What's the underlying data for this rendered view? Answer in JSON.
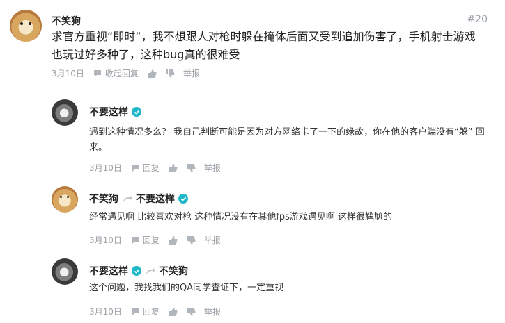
{
  "main": {
    "user": "不笑狗",
    "floor": "#20",
    "text": "求官方重视“即时”，我不想跟人对枪时躲在掩体后面又受到追加伤害了，手机射击游戏也玩过好多种了，这种bug真的很难受",
    "date": "3月10日",
    "collapse_label": "收起回复",
    "report_label": "举报"
  },
  "replies": [
    {
      "user": "不要这样",
      "verified": true,
      "reply_to": "",
      "text": "遇到这种情况多么？ 我自己判断可能是因为对方网络卡了一下的缘故，你在他的客户端没有“躲” 回来。",
      "date": "3月10日",
      "reply_label": "回复",
      "report_label": "举报"
    },
    {
      "user": "不笑狗",
      "verified": false,
      "reply_to": "不要这样",
      "reply_to_verified": true,
      "text": "经常遇见啊 比较喜欢对枪 这种情况没有在其他fps游戏遇见啊 这样很尴尬的",
      "date": "3月10日",
      "reply_label": "回复",
      "report_label": "举报"
    },
    {
      "user": "不要这样",
      "verified": true,
      "reply_to": "不笑狗",
      "reply_to_verified": false,
      "text": "这个问题，我找我们的QA同学查证下，一定重视",
      "date": "3月10日",
      "reply_label": "回复",
      "report_label": "举报"
    }
  ],
  "icons": {
    "collapse": "comment-icon",
    "reply": "comment-icon",
    "like": "thumbs-up-icon",
    "dislike": "thumbs-down-icon",
    "reply_arrow": "reply-arrow-icon",
    "verified": "verified-badge-icon"
  },
  "colors": {
    "accent_verified": "#20b8c8",
    "meta_gray": "#9aa0a6",
    "divider": "#ececec"
  }
}
